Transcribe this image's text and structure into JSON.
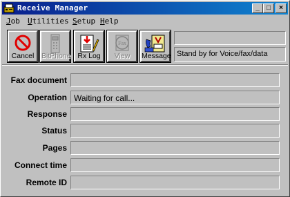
{
  "window": {
    "title": "Receive Manager"
  },
  "menu": [
    {
      "mnemonic": "J",
      "rest": "ob"
    },
    {
      "mnemonic": "U",
      "rest": "tilities"
    },
    {
      "mnemonic": "S",
      "rest": "etup"
    },
    {
      "mnemonic": "H",
      "rest": "elp"
    }
  ],
  "toolbar": {
    "buttons": [
      {
        "label": "Cancel",
        "icon": "cancel-icon",
        "enabled": true
      },
      {
        "label": "BitPhone",
        "icon": "phone-icon",
        "enabled": false
      },
      {
        "label": "Rx Log",
        "icon": "rx-log-icon",
        "enabled": true
      },
      {
        "label": "View",
        "icon": "fax-view-icon",
        "enabled": false
      },
      {
        "label": "Message",
        "icon": "message-icon",
        "enabled": true
      }
    ],
    "status_top": "",
    "status_bottom": "Stand by for Voice/fax/data"
  },
  "fields": [
    {
      "label": "Fax document",
      "value": ""
    },
    {
      "label": "Operation",
      "value": "Waiting for call..."
    },
    {
      "label": "Response",
      "value": ""
    },
    {
      "label": "Status",
      "value": ""
    },
    {
      "label": "Pages",
      "value": ""
    },
    {
      "label": "Connect time",
      "value": ""
    },
    {
      "label": "Remote ID",
      "value": ""
    }
  ],
  "colors": {
    "titlebar_start": "#0a1e8c",
    "titlebar_end": "#1084d0",
    "face": "#c0c0c0"
  }
}
